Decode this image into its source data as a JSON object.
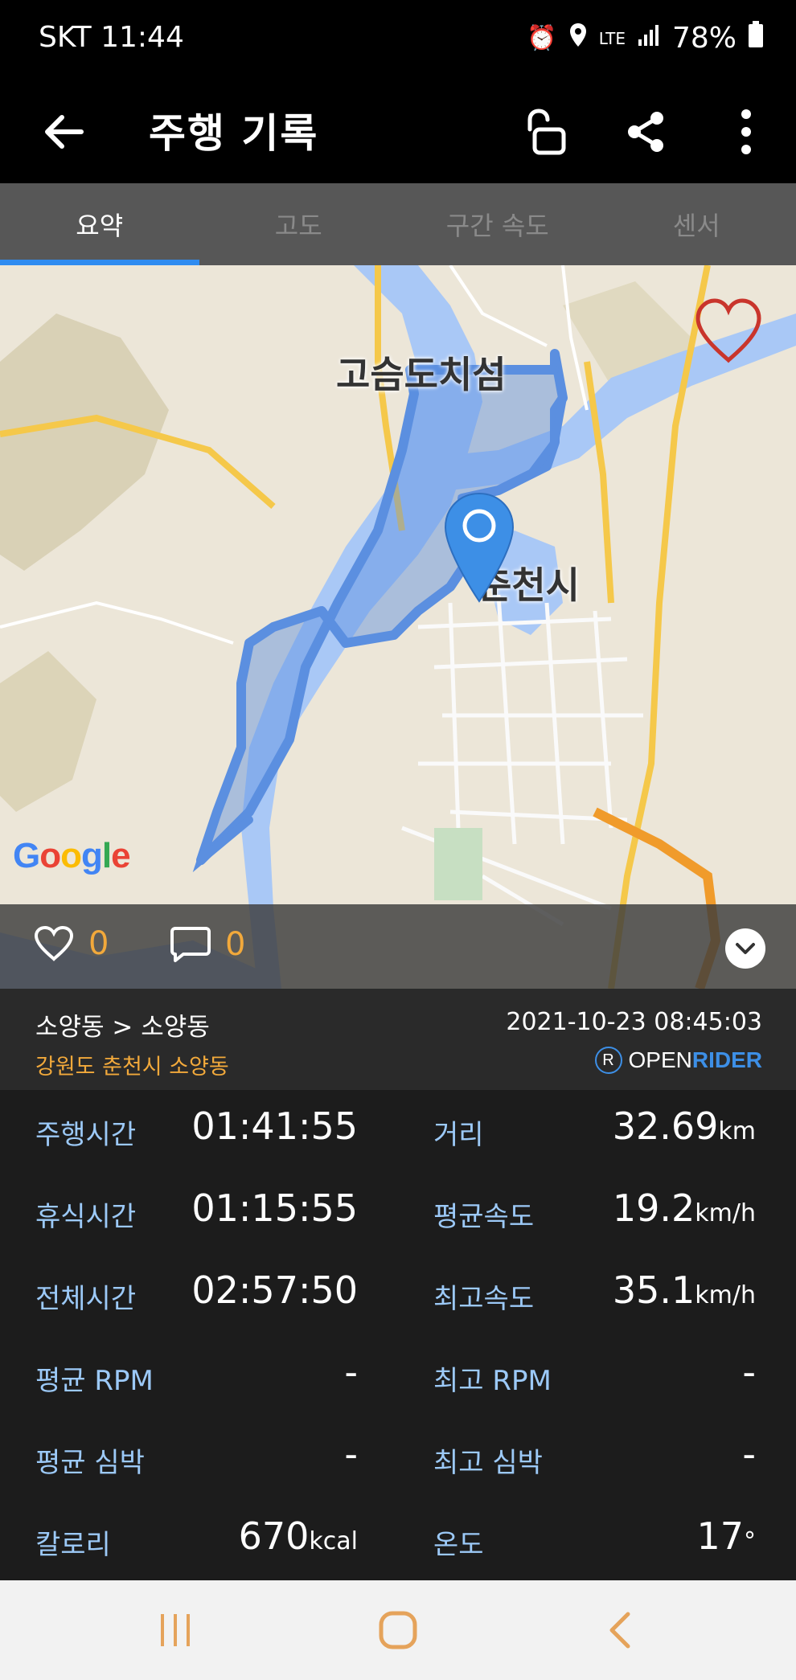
{
  "status_bar": {
    "carrier": "SKT",
    "time": "11:44",
    "network": "LTE",
    "battery": "78%"
  },
  "appbar": {
    "title": "주행 기록"
  },
  "tabs": [
    {
      "label": "요약",
      "active": true
    },
    {
      "label": "고도",
      "active": false
    },
    {
      "label": "구간 속도",
      "active": false
    },
    {
      "label": "센서",
      "active": false
    }
  ],
  "map": {
    "labels": {
      "island": "고슴도치섬",
      "city": "춘천시"
    },
    "attribution": "Google",
    "colors": {
      "route": "#5b8fe0",
      "water": "#a9c8f6",
      "marker": "#3d8fe6"
    }
  },
  "social": {
    "likes": "0",
    "comments": "0"
  },
  "ride_info": {
    "route": "소양동 > 소양동",
    "address": "강원도 춘천시 소양동",
    "datetime": "2021-10-23 08:45:03",
    "brand_open": "OPEN",
    "brand_rider": "RIDER"
  },
  "stats": {
    "ride_time": {
      "label": "주행시간",
      "value": "01:41:55"
    },
    "distance": {
      "label": "거리",
      "value": "32.69",
      "unit": "km"
    },
    "rest_time": {
      "label": "휴식시간",
      "value": "01:15:55"
    },
    "avg_speed": {
      "label": "평균속도",
      "value": "19.2",
      "unit": "km/h"
    },
    "total_time": {
      "label": "전체시간",
      "value": "02:57:50"
    },
    "max_speed": {
      "label": "최고속도",
      "value": "35.1",
      "unit": "km/h"
    },
    "avg_rpm": {
      "label": "평균 RPM",
      "value": "-"
    },
    "max_rpm": {
      "label": "최고 RPM",
      "value": "-"
    },
    "avg_hr": {
      "label": "평균 심박",
      "value": "-"
    },
    "max_hr": {
      "label": "최고 심박",
      "value": "-"
    },
    "calories": {
      "label": "칼로리",
      "value": "670",
      "unit": "kcal"
    },
    "temperature": {
      "label": "온도",
      "value": "17",
      "unit": "°"
    }
  }
}
